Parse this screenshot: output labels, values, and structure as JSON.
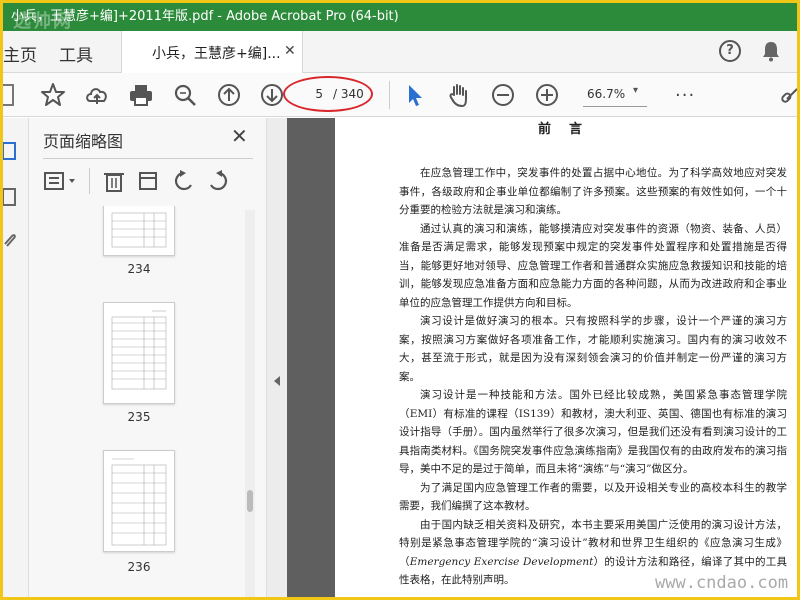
{
  "window": {
    "title": "小兵，王慧彦+编]+2011年版.pdf - Adobe Acrobat Pro (64-bit)"
  },
  "watermark_top": "选帅网",
  "tabs": {
    "home": "主页",
    "tools": "工具",
    "document": "小兵，王慧彦+编]...",
    "close": "✕"
  },
  "toolbar": {
    "page_current": "5",
    "page_total": "/ 340",
    "zoom": "66.7%",
    "zoom_caret": "▾",
    "more": "···"
  },
  "thumbnails": {
    "title": "页面缩略图",
    "close": "✕",
    "pages": [
      {
        "number": "234"
      },
      {
        "number": "235"
      },
      {
        "number": "236"
      }
    ]
  },
  "document": {
    "heading": "前言",
    "paragraphs": [
      "在应急管理工作中，突发事件的处置占据中心地位。为了科学高效地应对突发事件，各级政府和企事业单位都编制了许多预案。这些预案的有效性如何，一个十分重要的检验方法就是演习和演练。",
      "通过认真的演习和演练，能够摸清应对突发事件的资源（物资、装备、人员）准备是否满足需求，能够发现预案中规定的突发事件处置程序和处置措施是否得当，能够更好地对领导、应急管理工作者和普通群众实施应急救援知识和技能的培训，能够发现应急准备方面和应急能力方面的各种问题，从而为改进政府和企事业单位的应急管理工作提供方向和目标。",
      "演习设计是做好演习的根本。只有按照科学的步骤，设计一个严谨的演习方案，按照演习方案做好各项准备工作，才能顺利实施演习。国内有的演习收效不大，甚至流于形式，就是因为没有深刻领会演习的价值并制定一份严谨的演习方案。",
      "演习设计是一种技能和方法。国外已经比较成熟，美国紧急事态管理学院（EMI）有标准的课程（IS139）和教材，澳大利亚、英国、德国也有标准的演习设计指导（手册）。国内虽然举行了很多次演习，但是我们还没有看到演习设计的工具指南类材料。《国务院突发事件应急演练指南》是我国仅有的由政府发布的演习指导，美中不足的是过于简单，而且未将“演练”与“演习”做区分。",
      "为了满足国内应急管理工作者的需要，以及开设相关专业的高校本科生的教学需要，我们编撰了这本教材。"
    ],
    "last_paragraph_before": "由于国内缺乏相关资料及研究，本书主要采用美国广泛使用的演习设计方法，特别是紧急事态管理学院的“演习设计”教材和世界卫生组织的《应急演习生成》（",
    "last_paragraph_italic": "Emergency Exercise Development",
    "last_paragraph_after": "）的设计方法和路径，编译了其中的工具性表格，在此特别声明。"
  },
  "watermark_bottom": "www.cndao.com"
}
